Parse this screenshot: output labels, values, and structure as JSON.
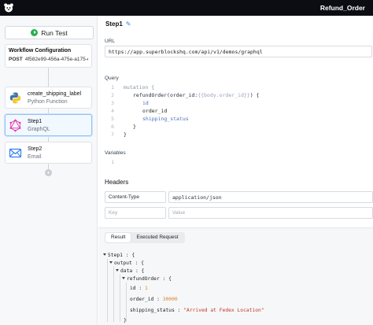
{
  "header": {
    "title": "Refund_Order"
  },
  "sidebar": {
    "run_label": "Run Test",
    "config": {
      "title": "Workflow Configuration",
      "method": "POST",
      "id": "4f582e99-456a-475e-a175-e..."
    },
    "steps": [
      {
        "name": "create_shipping_label",
        "type": "Python Function"
      },
      {
        "name": "Step1",
        "type": "GraphQL"
      },
      {
        "name": "Step2",
        "type": "Email"
      }
    ]
  },
  "main": {
    "step_title": "Step1",
    "url_label": "URL",
    "url_value": "https://app.superblockshq.com/api/v1/demos/graphql",
    "query_label": "Query",
    "query_lines": [
      {
        "n": "1",
        "t1": "mutation {"
      },
      {
        "n": "2",
        "t1": "refundOrder(order_id:",
        "t2": "{{body.order_id}}",
        "t3": ") {"
      },
      {
        "n": "3",
        "t1": "id"
      },
      {
        "n": "4",
        "t1": "order_id"
      },
      {
        "n": "5",
        "t1": "shipping_status"
      },
      {
        "n": "6",
        "t1": "}"
      },
      {
        "n": "7",
        "t1": "}"
      }
    ],
    "variables_label": "Variables",
    "variables_line": "1",
    "headers_title": "Headers",
    "header_row": {
      "key": "Content-Type",
      "value": "application/json"
    },
    "header_placeholder": {
      "key": "Key",
      "value": "Value"
    },
    "tabs": [
      "Result",
      "Executed Request"
    ],
    "result": {
      "root_key": "Step1",
      "output_key": "output",
      "data_key": "data",
      "refund_key": "refundOrder",
      "id_key": "id",
      "id_val": "1",
      "order_key": "order_id",
      "order_val": "30000",
      "ship_key": "shipping_status",
      "ship_val": "\"Arrived at Fedex Location\"",
      "open_brace": "{",
      "close_brace": "}"
    }
  },
  "colors": {
    "accent": "#2f80ed",
    "run_green": "#27b04b",
    "graphql_pink": "#e535ab",
    "topbar": "#0b0d12"
  }
}
